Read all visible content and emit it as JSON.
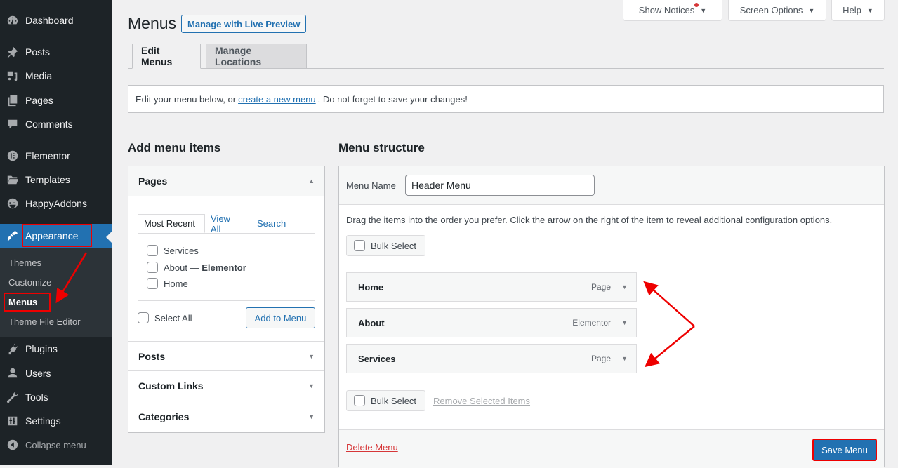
{
  "sidebar": {
    "items": [
      {
        "label": "Dashboard",
        "icon": "dashboard-icon"
      },
      {
        "label": "Posts",
        "icon": "pin-icon"
      },
      {
        "label": "Media",
        "icon": "media-icon"
      },
      {
        "label": "Pages",
        "icon": "pages-icon"
      },
      {
        "label": "Comments",
        "icon": "comment-icon"
      },
      {
        "label": "Elementor",
        "icon": "elementor-icon"
      },
      {
        "label": "Templates",
        "icon": "folder-icon"
      },
      {
        "label": "HappyAddons",
        "icon": "happy-face-icon"
      },
      {
        "label": "Appearance",
        "icon": "paintbrush-icon"
      },
      {
        "label": "Plugins",
        "icon": "plug-icon"
      },
      {
        "label": "Users",
        "icon": "user-icon"
      },
      {
        "label": "Tools",
        "icon": "wrench-icon"
      },
      {
        "label": "Settings",
        "icon": "sliders-icon"
      }
    ],
    "submenu": [
      "Themes",
      "Customize",
      "Menus",
      "Theme File Editor"
    ],
    "current_submenu": "Menus",
    "collapse_label": "Collapse menu"
  },
  "topbar": {
    "show_notices": "Show Notices",
    "screen_options": "Screen Options",
    "help": "Help"
  },
  "header": {
    "title": "Menus",
    "live_preview": "Manage with Live Preview",
    "tabs": [
      "Edit Menus",
      "Manage Locations"
    ],
    "active_tab": "Edit Menus"
  },
  "info": {
    "before": "Edit your menu below, or",
    "link": "create a new menu",
    "after": ". Do not forget to save your changes!"
  },
  "add_items": {
    "heading": "Add menu items",
    "sections": [
      "Pages",
      "Posts",
      "Custom Links",
      "Categories"
    ],
    "page_tabs": [
      "Most Recent",
      "View All",
      "Search"
    ],
    "pages": [
      {
        "label": "Services",
        "suffix": "",
        "checked": false
      },
      {
        "label": "About — ",
        "suffix": "Elementor",
        "checked": false
      },
      {
        "label": "Home",
        "suffix": "",
        "checked": false
      }
    ],
    "select_all": "Select All",
    "add_button": "Add to Menu"
  },
  "structure": {
    "heading": "Menu structure",
    "menu_name_label": "Menu Name",
    "menu_name_value": "Header Menu",
    "instructions": "Drag the items into the order you prefer. Click the arrow on the right of the item to reveal additional configuration options.",
    "bulk_select": "Bulk Select",
    "items": [
      {
        "title": "Home",
        "type": "Page"
      },
      {
        "title": "About",
        "type": "Elementor"
      },
      {
        "title": "Services",
        "type": "Page"
      }
    ],
    "remove_selected": "Remove Selected Items",
    "delete_menu": "Delete Menu",
    "save_menu": "Save Menu"
  },
  "colors": {
    "accent": "#2271b1",
    "sidebar_bg": "#1d2327",
    "annotation": "#ee0000",
    "delete": "#d63638"
  }
}
